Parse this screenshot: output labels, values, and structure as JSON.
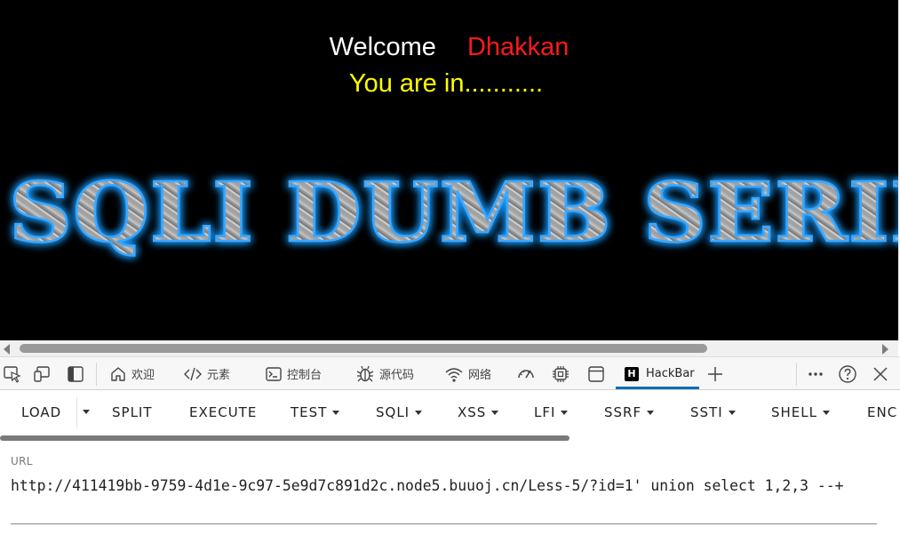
{
  "page": {
    "welcome_word": "Welcome",
    "welcome_name": "Dhakkan",
    "status_text": "You are in...........",
    "banner_text": "SQLI DUMB SERIES",
    "colors": {
      "welcome": "#ffffff",
      "name": "#ff1a1a",
      "status": "#ffff00",
      "background": "#000000",
      "banner_glow": "#1e9bff"
    }
  },
  "devtools": {
    "tabs": [
      {
        "label": "欢迎",
        "icon": "home-icon"
      },
      {
        "label": "元素",
        "icon": "code-icon"
      },
      {
        "label": "控制台",
        "icon": "console-icon"
      },
      {
        "label": "源代码",
        "icon": "bug-icon"
      },
      {
        "label": "网络",
        "icon": "wifi-icon"
      },
      {
        "label": "",
        "icon": "performance-icon"
      },
      {
        "label": "",
        "icon": "cpu-icon"
      },
      {
        "label": "",
        "icon": "application-icon"
      },
      {
        "label": "HackBar",
        "icon": "hackbar-logo-icon",
        "active": true
      }
    ],
    "hackbar_logo_letter": "H",
    "accent": "#0f6cbd"
  },
  "hackbar": {
    "buttons": {
      "load": "LOAD",
      "split": "SPLIT",
      "execute": "EXECUTE",
      "test": "TEST",
      "sqli": "SQLI",
      "xss": "XSS",
      "lfi": "LFI",
      "ssrf": "SSRF",
      "ssti": "SSTI",
      "shell": "SHELL",
      "enc": "ENC"
    },
    "url_label": "URL",
    "url_value": "http://411419bb-9759-4d1e-9c97-5e9d7c891d2c.node5.buuoj.cn/Less-5/?id=1' union select 1,2,3 --+"
  }
}
